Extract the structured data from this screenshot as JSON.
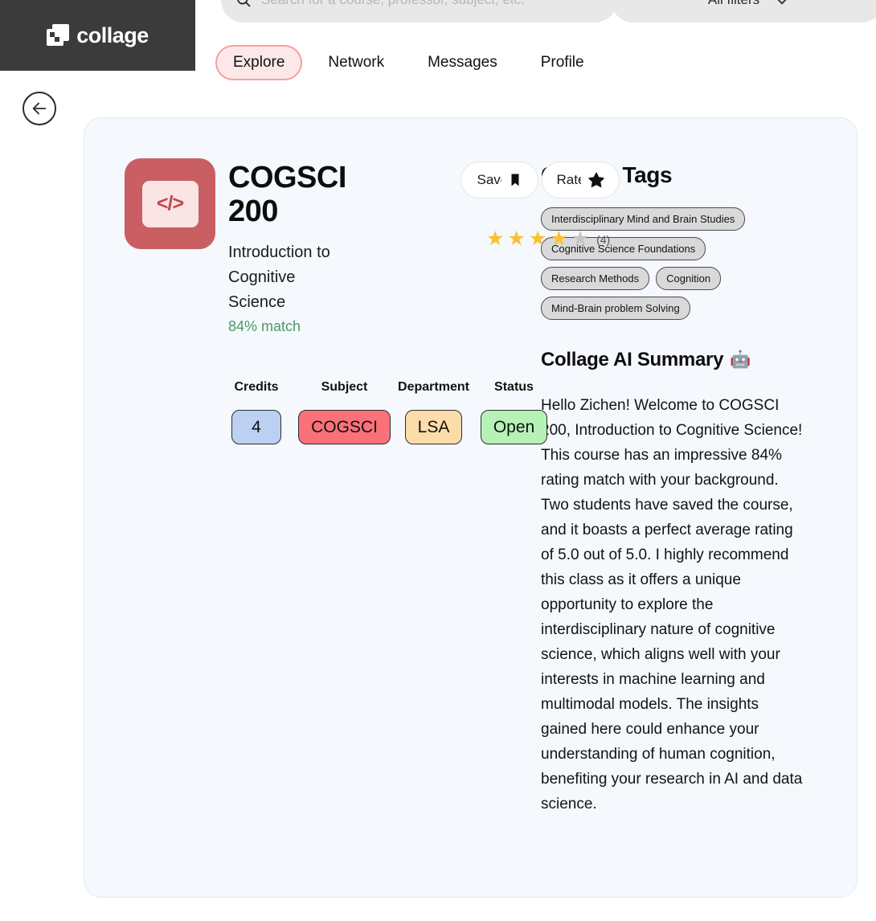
{
  "brand": {
    "name": "collage",
    "logo_icon": "collage-squares-icon",
    "panel_color": "#3b3b3b"
  },
  "search": {
    "icon": "search-icon",
    "placeholder": "Search for a course, professor, subject, etc.",
    "value": ""
  },
  "filters": {
    "label": "All filters",
    "icon": "chevron-down-icon"
  },
  "nav": {
    "items": [
      {
        "label": "Explore",
        "active": true
      },
      {
        "label": "Network",
        "active": false
      },
      {
        "label": "Messages",
        "active": false
      },
      {
        "label": "Profile",
        "active": false
      }
    ]
  },
  "back_button": {
    "icon": "arrow-left-icon"
  },
  "course": {
    "icon": "code-brackets-icon",
    "icon_glyph": "</>",
    "code": "COGSCI 200",
    "name": "Introduction to Cognitive Science",
    "match": "84% match",
    "actions": [
      {
        "label": "Save",
        "icon": "bookmark-icon"
      },
      {
        "label": "Rate",
        "icon": "star-icon"
      }
    ],
    "rating": {
      "filled": 4,
      "total": 5,
      "count_label": "(4)"
    },
    "stats": [
      {
        "label": "Credits",
        "value": "4",
        "color": "#bcd0f2"
      },
      {
        "label": "Subject",
        "value": "COGSCI",
        "color": "#fb7179"
      },
      {
        "label": "Department",
        "value": "LSA",
        "color": "#fcdcaa"
      },
      {
        "label": "Status",
        "value": "Open",
        "color": "#b6f2b6"
      }
    ]
  },
  "tags_section": {
    "title": "Course Tags",
    "tags": [
      "Interdisciplinary Mind and Brain Studies",
      "Cognitive Science Foundations",
      "Research Methods",
      "Cognition",
      "Mind-Brain problem Solving"
    ]
  },
  "summary_section": {
    "title": "Collage AI Summary",
    "emoji": "🤖",
    "text": "Hello Zichen! Welcome to COGSCI 200, Introduction to Cognitive Science! This course has an impressive 84% rating match with your background. Two students have saved the course, and it boasts a perfect average rating of 5.0 out of 5.0. I highly recommend this class as it offers a unique opportunity to explore the interdisciplinary nature of cognitive science, which aligns well with your interests in machine learning and multimodal models. The insights gained here could enhance your understanding of human cognition, benefiting your research in AI and data science."
  },
  "colors": {
    "accent_pink": "#f4a0a0",
    "accent_pink_bg": "#fce8e8",
    "card_bg": "#f5f8fd",
    "match_green": "#4b9b66",
    "icon_red": "#c95f62"
  }
}
